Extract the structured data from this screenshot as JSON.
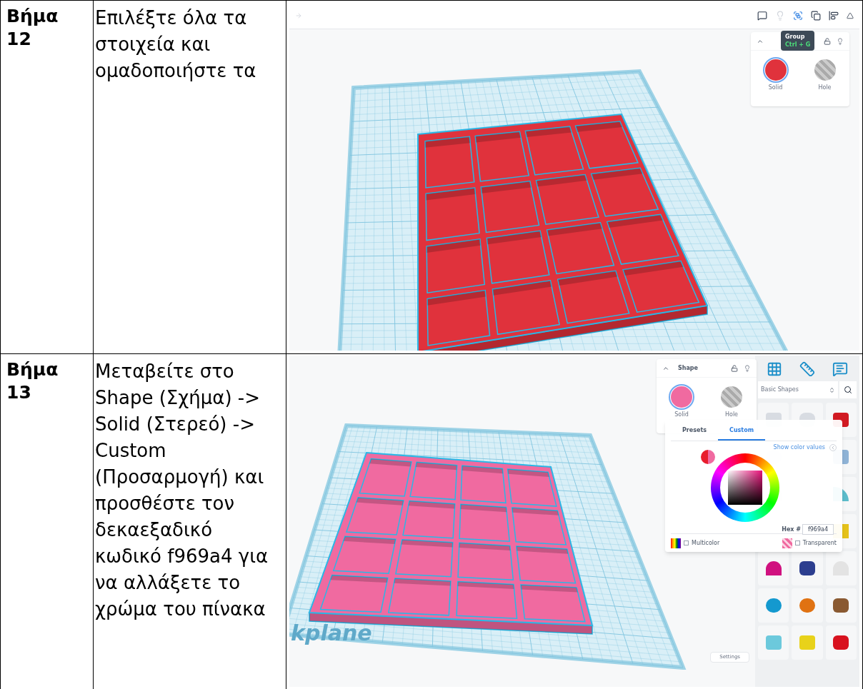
{
  "rows": [
    {
      "step": "Βήμα 12",
      "text": "Επιλέξτε όλα τα στοιχεία και ομαδοποιήστε τα",
      "screenshot": {
        "kind": "group",
        "color": "#e0323c",
        "tooltip": {
          "title": "Group",
          "shortcut": "Ctrl + G"
        },
        "panel": {
          "options": [
            {
              "label": "Solid",
              "selected": true
            },
            {
              "label": "Hole",
              "selected": false
            }
          ]
        }
      }
    },
    {
      "step": "Βήμα 13",
      "text": "Μεταβείτε στο Shape (Σχήμα) -> Solid (Στερεό) -> Custom (Προσαρμογή) και προσθέστε τον δεκαεξαδικό κωδικό f969a4 για να αλλάξετε το χρώμα του πίνακα",
      "screenshot": {
        "kind": "color",
        "color": "#f06aa0",
        "panel": {
          "title": "Shape",
          "options": [
            {
              "label": "Solid",
              "selected": true
            },
            {
              "label": "Hole",
              "selected": false
            }
          ]
        },
        "color_picker": {
          "tabs": [
            {
              "label": "Presets",
              "selected": false
            },
            {
              "label": "Custom",
              "selected": true
            }
          ],
          "show_values": "Show color values",
          "hex_label": "Hex #",
          "hex_value": "f969a4",
          "multicolor": {
            "label": "Multicolor",
            "checked": false
          },
          "transparent": {
            "label": "Transparent",
            "checked": false
          }
        },
        "library": {
          "category": "Basic Shapes"
        },
        "workplane_label": "kplane",
        "settings": "Settings"
      }
    }
  ]
}
